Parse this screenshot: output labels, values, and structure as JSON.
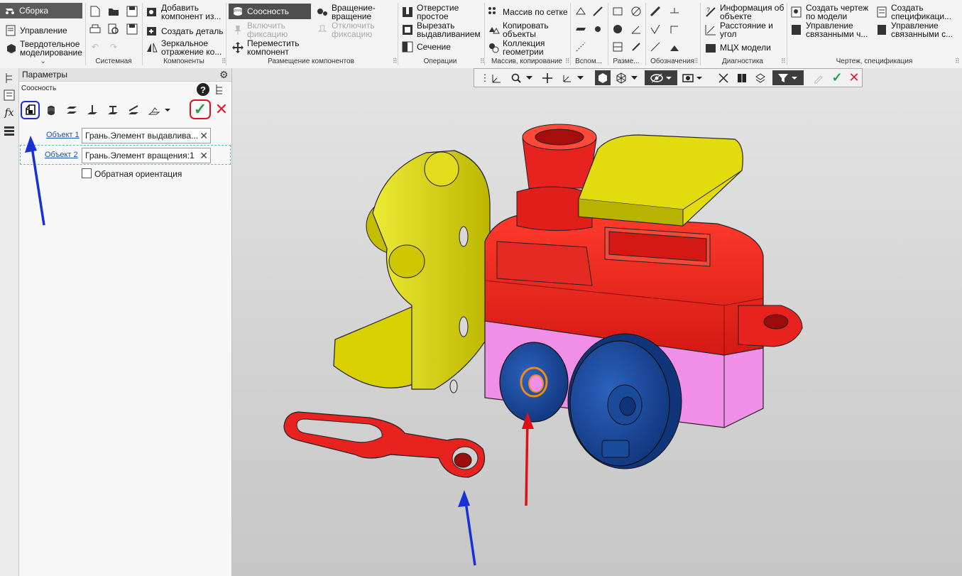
{
  "ribbon": {
    "mode": "Сборка",
    "mode_items": [
      "Управление",
      "Твердотельное\nмоделирование"
    ],
    "groups": {
      "system": "Системная",
      "components": "Компоненты",
      "placement": "Размещение компонентов",
      "operations": "Операции",
      "array_copy": "Массив, копирование",
      "aux": "Вспом...",
      "sizes": "Разме...",
      "designations": "Обозначения",
      "diagnostics": "Диагностика",
      "drawing": "Чертеж, спецификация"
    },
    "components_btns": [
      "Добавить\nкомпонент из...",
      "Создать деталь",
      "Зеркальное\nотражение ко..."
    ],
    "placement_btns": {
      "coaxial": "Соосность",
      "rotate": "Вращение-\nвращение",
      "enable_fix": "Включить\nфиксацию",
      "disable_fix": "Отключить\nфиксацию",
      "move": "Переместить\nкомпонент"
    },
    "operations_btns": [
      "Отверстие\nпростое",
      "Вырезать\nвыдавливанием",
      "Сечение"
    ],
    "array_btns": [
      "Массив по сетке",
      "Копировать\nобъекты",
      "Коллекция\nгеометрии"
    ],
    "diagnostics_btns": [
      "Информация об\nобъекте",
      "Расстояние и\nугол",
      "МЦХ модели"
    ],
    "drawing_btns": [
      "Создать чертеж\nпо модели",
      "Управление\nсвязанными ч...",
      "Создать\nспецификаци...",
      "Управление\nсвязанными с..."
    ]
  },
  "panel": {
    "title": "Параметры",
    "subtitle": "Соосность",
    "object1_label": "Объект 1",
    "object1_value": "Грань.Элемент выдавлива...",
    "object2_label": "Объект 2",
    "object2_value": "Грань.Элемент вращения:1",
    "reverse_orientation": "Обратная ориентация",
    "ok_symbol": "✓",
    "cancel_symbol": "✕",
    "help_symbol": "?"
  },
  "leftstrip": {
    "fx": "fx"
  },
  "colors": {
    "red_part": "#e8221f",
    "yellow_part": "#dcd400",
    "pink_part": "#f08ee8",
    "blue_part": "#1a4a9a",
    "highlight_orange": "#ee8a1c",
    "annotation_blue": "#1730d8",
    "annotation_red": "#e0101a",
    "ok_green": "#2a9d4b"
  }
}
